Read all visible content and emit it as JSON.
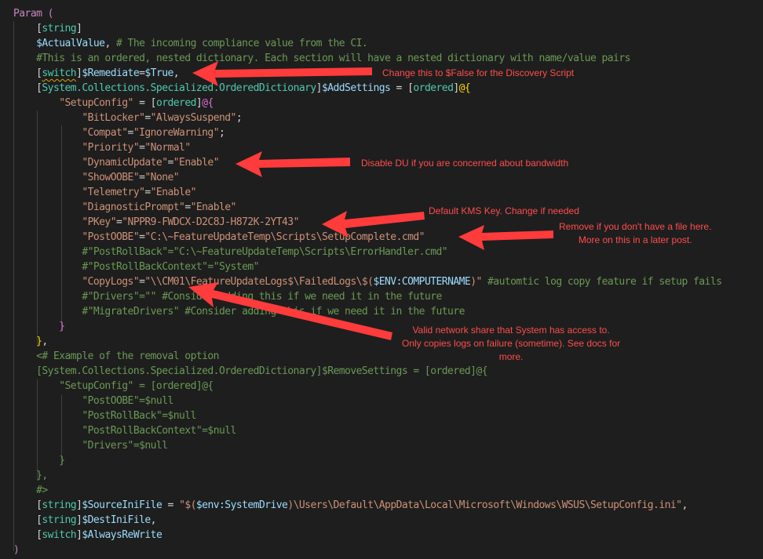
{
  "editor": {
    "language": "PowerShell",
    "theme": "dark",
    "colors": {
      "background": "#1e1e1e",
      "keyword": "#c586c0",
      "type": "#4ec9b0",
      "variable": "#9cdcfe",
      "string": "#ce9178",
      "comment": "#6a9955",
      "annotation": "#ff4d4d"
    },
    "lines": [
      [
        {
          "t": "Param (",
          "c": "kw"
        }
      ],
      [
        {
          "t": "    "
        },
        {
          "t": "[",
          "c": "op"
        },
        {
          "t": "string",
          "c": "type"
        },
        {
          "t": "]",
          "c": "op"
        }
      ],
      [
        {
          "t": "    "
        },
        {
          "t": "$ActualValue",
          "c": "var"
        },
        {
          "t": ", "
        },
        {
          "t": "# The incoming compliance value from the CI.",
          "c": "cmt"
        }
      ],
      [
        {
          "t": "    "
        },
        {
          "t": "#This is an ordered, nested dictionary. Each section will have a nested dictionary with name/value pairs",
          "c": "cmt"
        }
      ],
      [
        {
          "t": "    "
        },
        {
          "t": "[",
          "c": "op"
        },
        {
          "t": "switch",
          "c": "type",
          "sq": true
        },
        {
          "t": "]",
          "c": "op"
        },
        {
          "t": "$Remediate",
          "c": "var"
        },
        {
          "t": "="
        },
        {
          "t": "$True",
          "c": "var"
        },
        {
          "t": ","
        }
      ],
      [
        {
          "t": "    "
        },
        {
          "t": "[",
          "c": "op"
        },
        {
          "t": "System.Collections.Specialized.OrderedDictionary",
          "c": "type"
        },
        {
          "t": "]",
          "c": "op"
        },
        {
          "t": "$AddSettings",
          "c": "var"
        },
        {
          "t": " = "
        },
        {
          "t": "[",
          "c": "op"
        },
        {
          "t": "ordered",
          "c": "type"
        },
        {
          "t": "]",
          "c": "op"
        },
        {
          "t": "@{",
          "c": "by"
        }
      ],
      [
        {
          "t": "        "
        },
        {
          "t": "\"SetupConfig\"",
          "c": "str"
        },
        {
          "t": " = "
        },
        {
          "t": "[",
          "c": "op"
        },
        {
          "t": "ordered",
          "c": "type"
        },
        {
          "t": "]",
          "c": "op"
        },
        {
          "t": "@{",
          "c": "bp"
        }
      ],
      [
        {
          "t": "            "
        },
        {
          "t": "\"BitLocker\"",
          "c": "str"
        },
        {
          "t": "="
        },
        {
          "t": "\"AlwaysSuspend\"",
          "c": "str"
        },
        {
          "t": ";"
        }
      ],
      [
        {
          "t": "            "
        },
        {
          "t": "\"Compat\"",
          "c": "str"
        },
        {
          "t": "="
        },
        {
          "t": "\"IgnoreWarning\"",
          "c": "str"
        },
        {
          "t": ";"
        }
      ],
      [
        {
          "t": "            "
        },
        {
          "t": "\"Priority\"",
          "c": "str"
        },
        {
          "t": "="
        },
        {
          "t": "\"Normal\"",
          "c": "str"
        }
      ],
      [
        {
          "t": "            "
        },
        {
          "t": "\"DynamicUpdate\"",
          "c": "str"
        },
        {
          "t": "="
        },
        {
          "t": "\"Enable\"",
          "c": "str"
        }
      ],
      [
        {
          "t": "            "
        },
        {
          "t": "\"ShowOOBE\"",
          "c": "str"
        },
        {
          "t": "="
        },
        {
          "t": "\"None\"",
          "c": "str"
        }
      ],
      [
        {
          "t": "            "
        },
        {
          "t": "\"Telemetry\"",
          "c": "str"
        },
        {
          "t": "="
        },
        {
          "t": "\"Enable\"",
          "c": "str"
        }
      ],
      [
        {
          "t": "            "
        },
        {
          "t": "\"DiagnosticPrompt\"",
          "c": "str"
        },
        {
          "t": "="
        },
        {
          "t": "\"Enable\"",
          "c": "str"
        }
      ],
      [
        {
          "t": "            "
        },
        {
          "t": "\"PKey\"",
          "c": "str"
        },
        {
          "t": "="
        },
        {
          "t": "\"NPPR9-FWDCX-D2C8J-H872K-2YT43\"",
          "c": "str"
        }
      ],
      [
        {
          "t": "            "
        },
        {
          "t": "\"PostOOBE\"",
          "c": "str"
        },
        {
          "t": "="
        },
        {
          "t": "\"C:\\~FeatureUpdateTemp\\Scripts\\SetupComplete.cmd\"",
          "c": "str"
        }
      ],
      [
        {
          "t": "            "
        },
        {
          "t": "#\"PostRollBack\"=\"C:\\~FeatureUpdateTemp\\Scripts\\ErrorHandler.cmd\"",
          "c": "cmt"
        }
      ],
      [
        {
          "t": "            "
        },
        {
          "t": "#\"PostRollBackContext\"=\"System\"",
          "c": "cmt"
        }
      ],
      [
        {
          "t": "            "
        },
        {
          "t": "\"CopyLogs\"",
          "c": "str"
        },
        {
          "t": "="
        },
        {
          "t": "\"\\\\CM01\\FeatureUpdateLogs$\\FailedLogs\\$(",
          "c": "str"
        },
        {
          "t": "$ENV:COMPUTERNAME",
          "c": "var"
        },
        {
          "t": ")\"",
          "c": "str"
        },
        {
          "t": " "
        },
        {
          "t": "#automtic log copy feature if setup fails",
          "c": "cmt"
        }
      ],
      [
        {
          "t": "            "
        },
        {
          "t": "#\"Drivers\"=\"\" #Consider adding this if we need it in the future",
          "c": "cmt"
        }
      ],
      [
        {
          "t": "            "
        },
        {
          "t": "#\"MigrateDrivers\" #Consider adding this if we need it in the future",
          "c": "cmt"
        }
      ],
      [
        {
          "t": "        "
        },
        {
          "t": "}",
          "c": "bp"
        }
      ],
      [
        {
          "t": "    "
        },
        {
          "t": "}",
          "c": "by"
        },
        {
          "t": ","
        }
      ],
      [
        {
          "t": "    "
        },
        {
          "t": "<# Example of the removal option",
          "c": "cmt"
        }
      ],
      [
        {
          "t": "    "
        },
        {
          "t": "[System.Collections.Specialized.OrderedDictionary]$RemoveSettings = [ordered]@{",
          "c": "cmt"
        }
      ],
      [
        {
          "t": "        "
        },
        {
          "t": "\"SetupConfig\" = [ordered]@{",
          "c": "cmt"
        }
      ],
      [
        {
          "t": "            "
        },
        {
          "t": "\"PostOOBE\"=$null",
          "c": "cmt"
        }
      ],
      [
        {
          "t": "            "
        },
        {
          "t": "\"PostRollBack\"=$null",
          "c": "cmt"
        }
      ],
      [
        {
          "t": "            "
        },
        {
          "t": "\"PostRollBackContext\"=$null",
          "c": "cmt"
        }
      ],
      [
        {
          "t": "            "
        },
        {
          "t": "\"Drivers\"=$null",
          "c": "cmt"
        }
      ],
      [
        {
          "t": "        "
        },
        {
          "t": "}",
          "c": "cmt"
        }
      ],
      [
        {
          "t": "    "
        },
        {
          "t": "},",
          "c": "cmt"
        }
      ],
      [
        {
          "t": "    "
        },
        {
          "t": "#>",
          "c": "cmt"
        }
      ],
      [
        {
          "t": "    "
        },
        {
          "t": "[",
          "c": "op"
        },
        {
          "t": "string",
          "c": "type"
        },
        {
          "t": "]",
          "c": "op"
        },
        {
          "t": "$SourceIniFile",
          "c": "var"
        },
        {
          "t": " = "
        },
        {
          "t": "\"$(",
          "c": "str"
        },
        {
          "t": "$env:SystemDrive",
          "c": "var"
        },
        {
          "t": ")\\Users\\Default\\AppData\\Local\\Microsoft\\Windows\\WSUS\\SetupConfig.ini\"",
          "c": "str"
        },
        {
          "t": ","
        }
      ],
      [
        {
          "t": "    "
        },
        {
          "t": "[",
          "c": "op"
        },
        {
          "t": "string",
          "c": "type"
        },
        {
          "t": "]",
          "c": "op"
        },
        {
          "t": "$DestIniFile",
          "c": "var"
        },
        {
          "t": ","
        }
      ],
      [
        {
          "t": "    "
        },
        {
          "t": "[",
          "c": "op"
        },
        {
          "t": "switch",
          "c": "type"
        },
        {
          "t": "]",
          "c": "op"
        },
        {
          "t": "$AlwaysReWrite",
          "c": "var"
        }
      ],
      [
        {
          "t": ")",
          "c": "kw"
        }
      ]
    ]
  },
  "annotations": [
    {
      "id": "remediate-note",
      "text": "Change this to $False for the Discovery Script"
    },
    {
      "id": "du-note",
      "text": "Disable DU if you are concerned about bandwidth"
    },
    {
      "id": "pkey-note",
      "text": "Default KMS Key. Change if needed"
    },
    {
      "id": "postoobe-note",
      "text": "Remove if you don't have a file here.\nMore on this in a later post."
    },
    {
      "id": "copylogs-note",
      "text": "Valid network share that System has access to.\nOnly copies logs on failure (sometime). See docs for\nmore."
    }
  ]
}
